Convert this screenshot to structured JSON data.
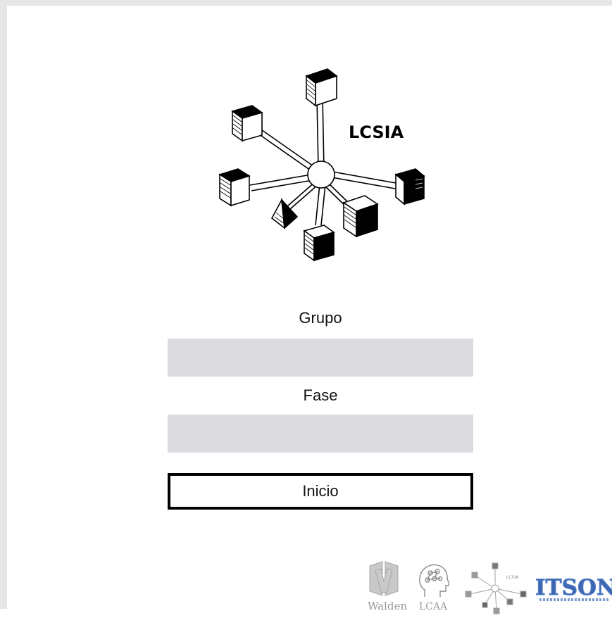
{
  "logo": {
    "title": "LCSIA"
  },
  "form": {
    "grupo_label": "Grupo",
    "grupo_value": "",
    "fase_label": "Fase",
    "fase_value": "",
    "submit_label": "Inicio"
  },
  "footer": {
    "walden_label": "Walden",
    "lcaa_label": "LCAA",
    "lcsia_label": "LCSIA",
    "itson_label": "ITSON"
  },
  "colors": {
    "field_background": "#dcdce0",
    "button_border": "#000000",
    "itson_blue": "#3b67b3"
  }
}
